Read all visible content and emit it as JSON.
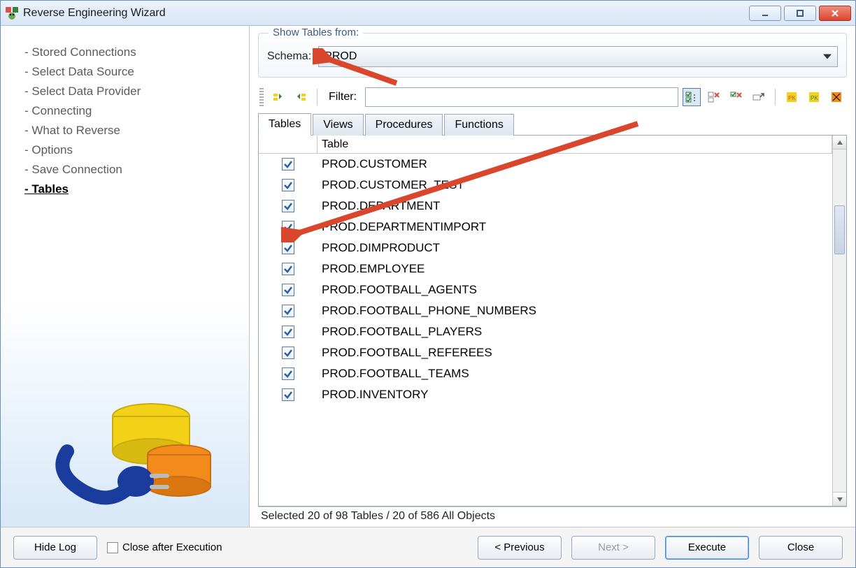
{
  "window": {
    "title": "Reverse Engineering Wizard"
  },
  "sidebar": {
    "steps": [
      "- Stored Connections",
      "- Select Data Source",
      "- Select Data Provider",
      "- Connecting",
      "- What to Reverse",
      "- Options",
      "- Save Connection",
      "- Tables"
    ],
    "current_index": 7
  },
  "group": {
    "legend": "Show Tables from:",
    "schema_label": "Schema:",
    "schema_value": "PROD"
  },
  "toolbar": {
    "filter_label": "Filter:",
    "filter_value": "",
    "icons": {
      "select_all_schema": "select-all-schema-icon",
      "deselect_all_schema": "deselect-all-schema-icon",
      "check_all": "check-all-icon",
      "uncheck_all": "uncheck-all-icon",
      "check_filtered": "check-filtered-icon",
      "uncheck_filtered": "uncheck-filtered-icon",
      "pk1": "pk-action-1-icon",
      "pk2": "pk-action-2-icon",
      "pk3": "pk-action-3-icon"
    }
  },
  "tabs": {
    "items": [
      "Tables",
      "Views",
      "Procedures",
      "Functions"
    ],
    "active_index": 0
  },
  "table": {
    "header": "Table",
    "rows": [
      {
        "checked": true,
        "name": "PROD.CUSTOMER"
      },
      {
        "checked": true,
        "name": "PROD.CUSTOMER_TEST"
      },
      {
        "checked": true,
        "name": "PROD.DEPARTMENT"
      },
      {
        "checked": true,
        "name": "PROD.DEPARTMENTIMPORT"
      },
      {
        "checked": true,
        "name": "PROD.DIMPRODUCT"
      },
      {
        "checked": true,
        "name": "PROD.EMPLOYEE"
      },
      {
        "checked": true,
        "name": "PROD.FOOTBALL_AGENTS"
      },
      {
        "checked": true,
        "name": "PROD.FOOTBALL_PHONE_NUMBERS"
      },
      {
        "checked": true,
        "name": "PROD.FOOTBALL_PLAYERS"
      },
      {
        "checked": true,
        "name": "PROD.FOOTBALL_REFEREES"
      },
      {
        "checked": true,
        "name": "PROD.FOOTBALL_TEAMS"
      },
      {
        "checked": true,
        "name": "PROD.INVENTORY"
      }
    ]
  },
  "status": "Selected 20 of 98 Tables / 20 of 586 All Objects",
  "bottom": {
    "hide_log": "Hide Log",
    "close_after": "Close after Execution",
    "previous": "< Previous",
    "next": "Next >",
    "execute": "Execute",
    "close": "Close"
  }
}
